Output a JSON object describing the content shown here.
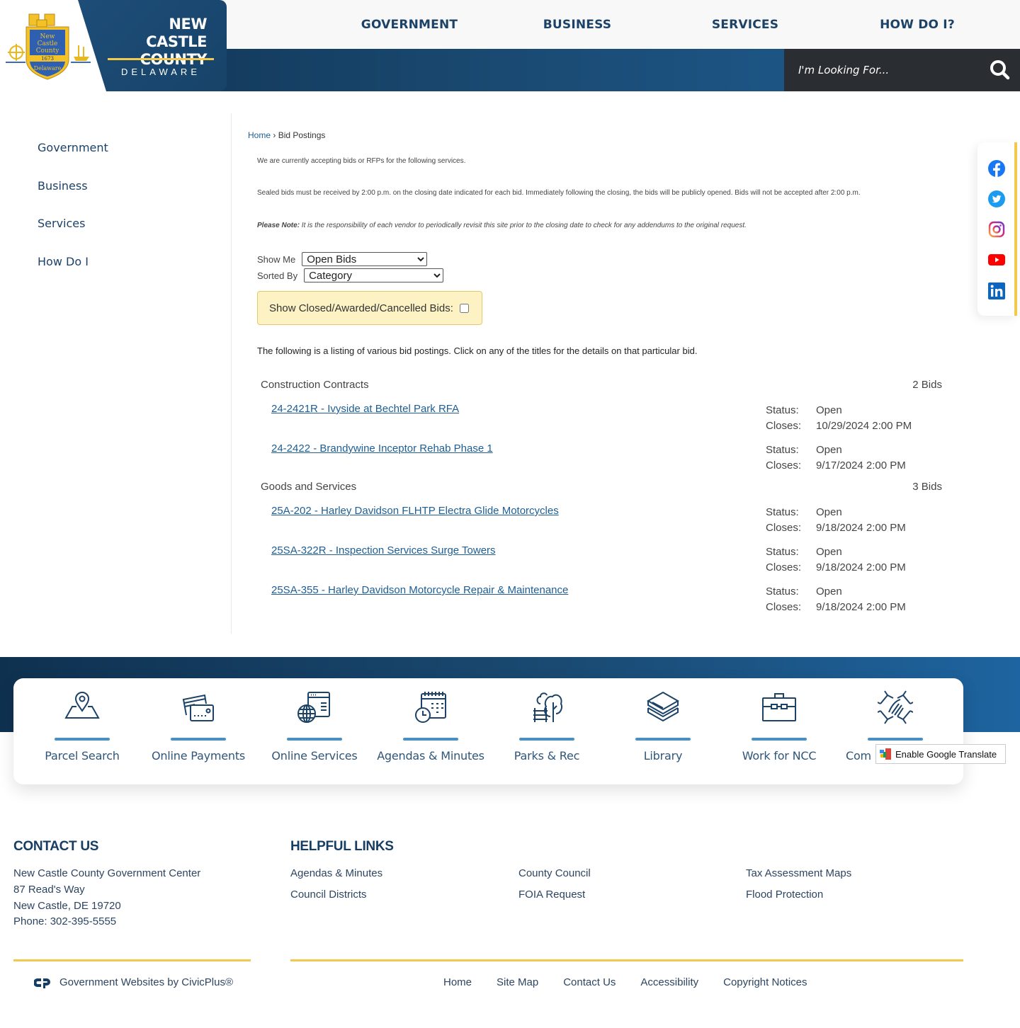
{
  "brand": {
    "line1": "NEW CASTLE",
    "line2": "COUNTY",
    "sub": "DELAWARE",
    "seal_text": [
      "New",
      "Castle",
      "County",
      "1673",
      "Delaware"
    ]
  },
  "colors": {
    "navy": "#163d63",
    "link": "#1e5e94",
    "accent_gold": "#f2c94c",
    "search_bg": "#2a2d32",
    "quicklink_bar": "#4a8fc4",
    "notice_bg": "#fcf2c4"
  },
  "top_nav": [
    {
      "label": "GOVERNMENT"
    },
    {
      "label": "BUSINESS"
    },
    {
      "label": "SERVICES"
    },
    {
      "label": "HOW DO I?"
    }
  ],
  "search": {
    "placeholder": "I'm Looking For...",
    "icon": "search-icon"
  },
  "sidebar": {
    "items": [
      {
        "label": "Government"
      },
      {
        "label": "Business"
      },
      {
        "label": "Services"
      },
      {
        "label": "How Do I"
      }
    ]
  },
  "breadcrumb": {
    "home": "Home",
    "separator": "›",
    "current": "Bid Postings"
  },
  "intro": {
    "p1": "We are currently accepting bids or RFPs for the following services.",
    "p2": "Sealed bids must be received by 2:00 p.m. on the closing date indicated for each bid. Immediately following the closing, the bids will be publicly opened. Bids will not be accepted after 2:00 p.m.",
    "note_label": "Please Note:",
    "note_text": " It is the responsibility of each vendor to periodically revisit this site prior to the closing date to check for any addendums to the original request."
  },
  "filters": {
    "show_me_label": "Show Me",
    "show_me_value": "Open Bids",
    "sorted_by_label": "Sorted By",
    "sorted_by_value": "Category",
    "closed_label": "Show Closed/Awarded/Cancelled Bids:",
    "closed_checked": false
  },
  "listing_note": "The following is a listing of various bid postings. Click on any of the titles for the details on that particular bid.",
  "status_label": "Status:",
  "closes_label": "Closes:",
  "categories": [
    {
      "name": "Construction Contracts",
      "count": "2 Bids",
      "bids": [
        {
          "title": "24-2421R - Ivyside at Bechtel Park RFA",
          "status": "Open",
          "closes": "10/29/2024 2:00 PM"
        },
        {
          "title": "24-2422 - Brandywine Inceptor Rehab Phase 1",
          "status": "Open",
          "closes": "9/17/2024 2:00 PM"
        }
      ]
    },
    {
      "name": "Goods and Services",
      "count": "3 Bids",
      "bids": [
        {
          "title": "25A-202 - Harley Davidson FLHTP Electra Glide Motorcycles",
          "status": "Open",
          "closes": "9/18/2024 2:00 PM"
        },
        {
          "title": "25SA-322R - Inspection Services Surge Towers",
          "status": "Open",
          "closes": "9/18/2024 2:00 PM"
        },
        {
          "title": "25SA-355 - Harley Davidson Motorcycle Repair & Maintenance",
          "status": "Open",
          "closes": "9/18/2024 2:00 PM"
        }
      ]
    }
  ],
  "social": [
    {
      "name": "facebook-icon",
      "color": "#1877f2"
    },
    {
      "name": "twitter-icon",
      "color": "#1d9bf0"
    },
    {
      "name": "instagram-icon",
      "color": "#d62976"
    },
    {
      "name": "youtube-icon",
      "color": "#ff0000"
    },
    {
      "name": "linkedin-icon",
      "color": "#0a66c2"
    }
  ],
  "quick_links": [
    {
      "label": "Parcel Search",
      "icon": "map-pin-icon"
    },
    {
      "label": "Online Payments",
      "icon": "credit-card-icon"
    },
    {
      "label": "Online Services",
      "icon": "globe-browser-icon"
    },
    {
      "label": "Agendas & Minutes",
      "icon": "calendar-clock-icon"
    },
    {
      "label": "Parks & Rec",
      "icon": "park-bench-tree-icon"
    },
    {
      "label": "Library",
      "icon": "books-icon"
    },
    {
      "label": "Work for NCC",
      "icon": "briefcase-icon"
    },
    {
      "label": "Com",
      "icon": "handshake-icon"
    }
  ],
  "google_translate": {
    "label": "Enable Google Translate"
  },
  "footer": {
    "contact_heading": "CONTACT US",
    "contact_lines": [
      "New Castle County Government Center",
      "87 Read's Way",
      "New Castle, DE 19720",
      "Phone: 302-395-5555"
    ],
    "links_heading": "HELPFUL LINKS",
    "links": [
      [
        "Agendas & Minutes",
        "Council Districts"
      ],
      [
        "County Council",
        "FOIA Request"
      ],
      [
        "Tax Assessment Maps",
        "Flood Protection"
      ]
    ],
    "civicplus": "Government Websites by CivicPlus®",
    "bottom_nav": [
      "Home",
      "Site Map",
      "Contact Us",
      "Accessibility",
      "Copyright Notices"
    ]
  }
}
